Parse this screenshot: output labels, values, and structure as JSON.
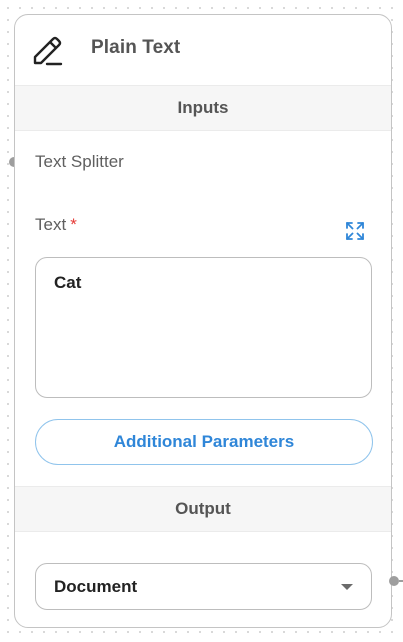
{
  "node": {
    "title": "Plain Text",
    "icon": "pencil-icon"
  },
  "inputs": {
    "section_label": "Inputs",
    "anchor_label": "Text Splitter",
    "text_field": {
      "label": "Text",
      "required_marker": "*",
      "value": "Cat",
      "expand_icon": "expand-icon"
    },
    "additional_params_label": "Additional Parameters"
  },
  "output": {
    "section_label": "Output",
    "selected_value": "Document",
    "dropdown_icon": "caret-down-icon"
  },
  "colors": {
    "accent": "#2f86d8",
    "required": "#e53935",
    "handle": "#9e9e9e"
  }
}
